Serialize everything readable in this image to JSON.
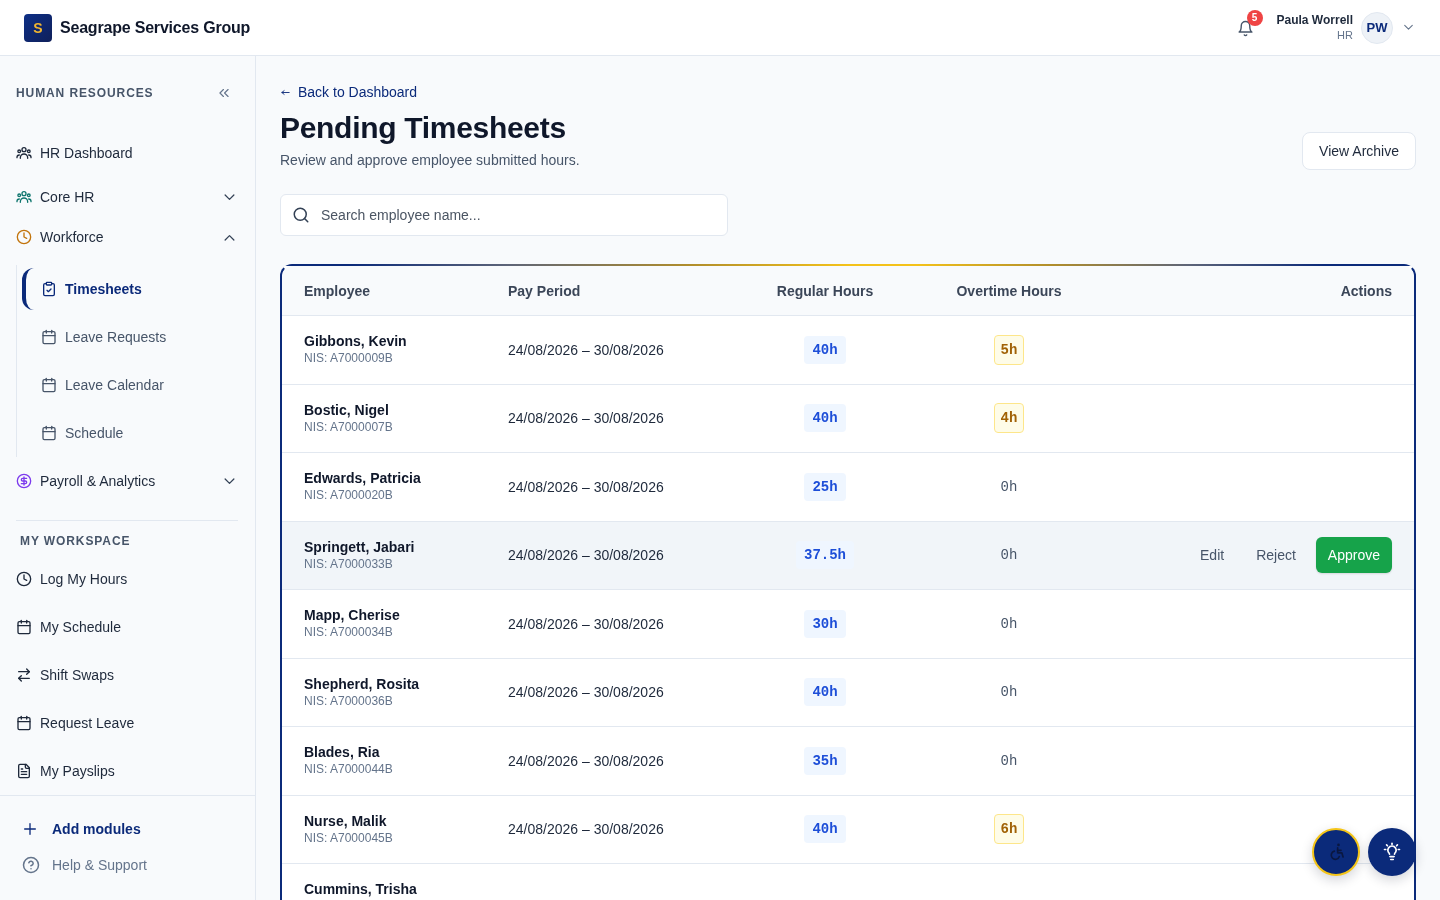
{
  "topbar": {
    "logo_letter": "S",
    "brand": "Seagrape Services Group",
    "notification_count": "5",
    "user": {
      "name": "Paula Worrell",
      "role": "HR",
      "initials": "PW"
    }
  },
  "sidebar": {
    "title": "HUMAN RESOURCES",
    "nav": [
      {
        "label": "HR Dashboard",
        "color": "#1e293b",
        "selected": false
      },
      {
        "label": "Core HR",
        "color": "#0f766e",
        "selected": false,
        "expanded": false
      },
      {
        "label": "Workforce",
        "color": "#c2740c",
        "selected": false,
        "expanded": true,
        "children": [
          {
            "label": "Timesheets",
            "selected": true
          },
          {
            "label": "Leave Requests",
            "selected": false
          },
          {
            "label": "Leave Calendar",
            "selected": false
          },
          {
            "label": "Schedule",
            "selected": false
          }
        ]
      },
      {
        "label": "Payroll & Analytics",
        "color": "#7c3aed",
        "selected": false,
        "expanded": false
      }
    ],
    "workspace": {
      "title": "MY WORKSPACE",
      "items": [
        {
          "label": "Log My Hours",
          "selected": false
        },
        {
          "label": "My Schedule",
          "selected": false
        },
        {
          "label": "Shift Swaps",
          "selected": false
        },
        {
          "label": "Request Leave",
          "selected": false
        },
        {
          "label": "My Payslips",
          "selected": false
        }
      ]
    },
    "footer": [
      {
        "label": "Add modules",
        "kind": "add"
      },
      {
        "label": "Help & Support",
        "kind": "help"
      }
    ]
  },
  "page": {
    "back_link": "Back to Dashboard",
    "title": "Pending Timesheets",
    "subtitle": "Review and approve employee submitted hours.",
    "archive_button": "View Archive",
    "search": {
      "placeholder": "Search employee name..."
    }
  },
  "table": {
    "columns": [
      "Employee",
      "Pay Period",
      "Regular Hours",
      "Overtime Hours",
      "Actions"
    ],
    "rows": [
      {
        "name": "Gibbons, Kevin",
        "nis": "NIS: A7000009B",
        "pay_period": "24/08/2026 – 30/08/2026",
        "regular_hours": "40h",
        "overtime": {
          "text": "5h",
          "kind": "badge"
        },
        "highlighted": false
      },
      {
        "name": "Bostic, Nigel",
        "nis": "NIS: A7000007B",
        "pay_period": "24/08/2026 – 30/08/2026",
        "regular_hours": "40h",
        "overtime": {
          "text": "4h",
          "kind": "badge"
        },
        "highlighted": false
      },
      {
        "name": "Edwards, Patricia",
        "nis": "NIS: A7000020B",
        "pay_period": "24/08/2026 – 30/08/2026",
        "regular_hours": "25h",
        "overtime": {
          "text": "0h",
          "kind": "plain"
        },
        "highlighted": false
      },
      {
        "name": "Springett, Jabari",
        "nis": "NIS: A7000033B",
        "pay_period": "24/08/2026 – 30/08/2026",
        "regular_hours": "37.5h",
        "overtime": {
          "text": "0h",
          "kind": "plain"
        },
        "highlighted": true,
        "actions": [
          {
            "label": "Edit",
            "kind": "text"
          },
          {
            "label": "Reject",
            "kind": "text"
          },
          {
            "label": "Approve",
            "kind": "primary"
          }
        ]
      },
      {
        "name": "Mapp, Cherise",
        "nis": "NIS: A7000034B",
        "pay_period": "24/08/2026 – 30/08/2026",
        "regular_hours": "30h",
        "overtime": {
          "text": "0h",
          "kind": "plain"
        },
        "highlighted": false
      },
      {
        "name": "Shepherd, Rosita",
        "nis": "NIS: A7000036B",
        "pay_period": "24/08/2026 – 30/08/2026",
        "regular_hours": "40h",
        "overtime": {
          "text": "0h",
          "kind": "plain"
        },
        "highlighted": false
      },
      {
        "name": "Blades, Ria",
        "nis": "NIS: A7000044B",
        "pay_period": "24/08/2026 – 30/08/2026",
        "regular_hours": "35h",
        "overtime": {
          "text": "0h",
          "kind": "plain"
        },
        "highlighted": false
      },
      {
        "name": "Nurse, Malik",
        "nis": "NIS: A7000045B",
        "pay_period": "24/08/2026 – 30/08/2026",
        "regular_hours": "40h",
        "overtime": {
          "text": "6h",
          "kind": "badge"
        },
        "highlighted": false
      },
      {
        "name": "Cummins, Trisha",
        "highlighted": false
      }
    ]
  }
}
